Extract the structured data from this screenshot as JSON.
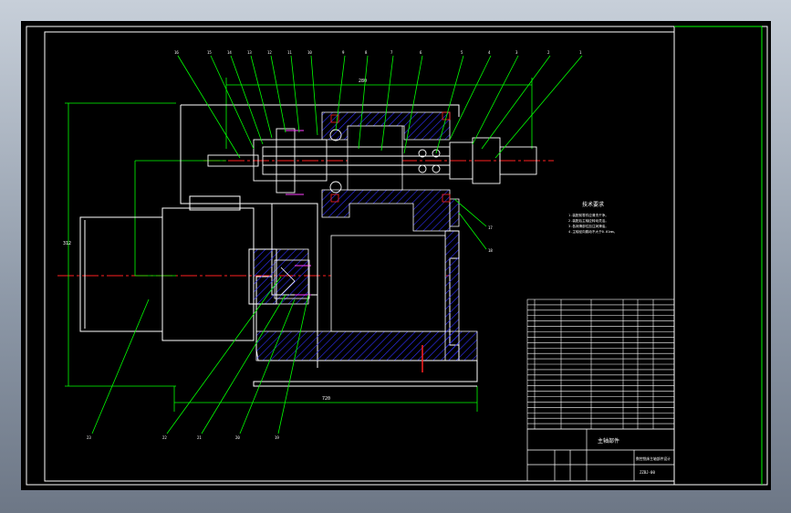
{
  "drawing": {
    "notes_title": "技术要求",
    "notes": [
      "1.装配前零件应清洗干净。",
      "2.装配后主轴应转动灵活。",
      "3.各润滑部位加注润滑油。",
      "4.主轴径向跳动不大于0.01mm。"
    ],
    "dims": {
      "top": "280",
      "bottom": "720",
      "left": "312"
    },
    "colors": {
      "background": "#000000",
      "outline": "#ffffff",
      "leader": "#00ff00",
      "centerline": "#ff2020",
      "hatch": "#3030ff",
      "frame": "#ffffff",
      "accent": "#ff40ff"
    }
  },
  "title_block": {
    "name": "主轴部件",
    "subtitle": "数控铣床主轴部件设计",
    "drawing_no": "ZZBJ-00"
  }
}
